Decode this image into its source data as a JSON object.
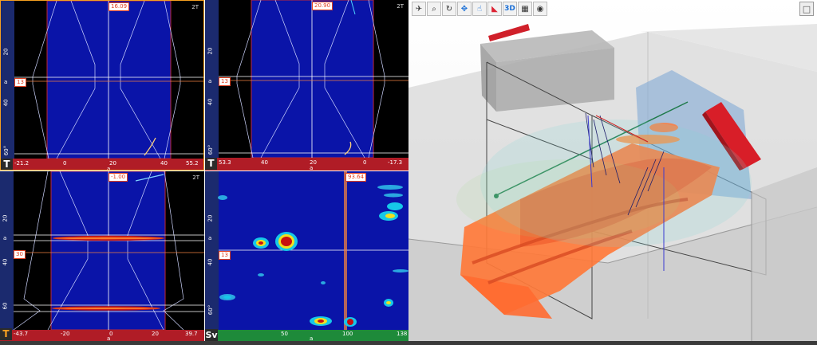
{
  "toolbar": {
    "tools": [
      {
        "name": "bulb-icon",
        "glyph": "✈"
      },
      {
        "name": "zoom-icon",
        "glyph": "⌕"
      },
      {
        "name": "rotate-icon",
        "glyph": "↻"
      },
      {
        "name": "pan-icon",
        "glyph": "✥"
      },
      {
        "name": "select-icon",
        "glyph": "☝"
      },
      {
        "name": "eraser-icon",
        "glyph": "◣"
      },
      {
        "name": "view3d-icon",
        "glyph": "3D"
      },
      {
        "name": "layers-icon",
        "glyph": "▦"
      },
      {
        "name": "eye-icon",
        "glyph": "◉"
      }
    ]
  },
  "panes": {
    "top_left": {
      "mode": "T",
      "corner": "2T",
      "cursor_top": "16.09",
      "cursor_side": "13",
      "axis_left_labels": [
        "20",
        "40",
        "60°"
      ],
      "axis_unit": "a",
      "bottom_labels": [
        "-21.2",
        "0",
        "20",
        "40",
        "55.2"
      ],
      "bottom_unit": "a"
    },
    "top_right": {
      "mode": "T",
      "corner": "2T",
      "cursor_top": "20.90",
      "cursor_side": "13",
      "axis_left_labels": [
        "20",
        "40",
        "60°"
      ],
      "axis_unit": "a",
      "bottom_labels": [
        "53.3",
        "40",
        "20",
        "0",
        "-17.3"
      ],
      "bottom_unit": "a"
    },
    "bottom_left": {
      "mode": "T",
      "corner": "2T",
      "cursor_top": "-1.00",
      "cursor_side": "30",
      "axis_left_labels": [
        "20",
        "40",
        "60"
      ],
      "axis_unit": "a",
      "bottom_labels": [
        "-43.7",
        "-20",
        "0",
        "20",
        "39.7"
      ],
      "bottom_unit": "a"
    },
    "bottom_right": {
      "mode": "Sv",
      "cursor_top": "93.64",
      "cursor_side": "13",
      "axis_left_labels": [
        "20",
        "40",
        "60°"
      ],
      "axis_unit": "a",
      "bottom_labels": [
        "50",
        "100",
        "138"
      ],
      "bottom_unit": "a"
    }
  },
  "colors": {
    "scan_background": "#0a14a8",
    "pane_border_orange": "#f6a020",
    "axis_red": "#c8202a",
    "axis_green": "#1e8a3a"
  }
}
